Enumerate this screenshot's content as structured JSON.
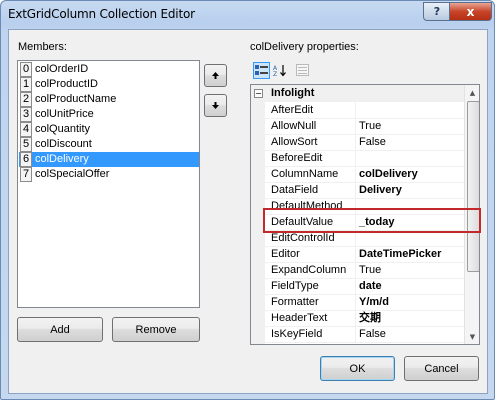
{
  "window": {
    "title": "ExtGridColumn Collection Editor"
  },
  "titlebar_buttons": {
    "help": "?",
    "close": "x"
  },
  "members": {
    "label": "Members:",
    "items": [
      {
        "index": "0",
        "name": "colOrderID"
      },
      {
        "index": "1",
        "name": "colProductID"
      },
      {
        "index": "2",
        "name": "colProductName"
      },
      {
        "index": "3",
        "name": "colUnitPrice"
      },
      {
        "index": "4",
        "name": "colQuantity"
      },
      {
        "index": "5",
        "name": "colDiscount"
      },
      {
        "index": "6",
        "name": "colDelivery",
        "selected": true
      },
      {
        "index": "7",
        "name": "colSpecialOffer"
      }
    ],
    "add_label": "Add",
    "remove_label": "Remove"
  },
  "move_buttons": {
    "up_icon": "arrow-up-icon",
    "down_icon": "arrow-down-icon"
  },
  "properties": {
    "label": "colDelivery properties:",
    "toolbar": [
      "categorized-icon",
      "alphabetical-icon",
      "property-pages-icon"
    ],
    "category": "Infolight",
    "rows": [
      {
        "name": "AfterEdit",
        "value": ""
      },
      {
        "name": "AllowNull",
        "value": "True"
      },
      {
        "name": "AllowSort",
        "value": "False"
      },
      {
        "name": "BeforeEdit",
        "value": ""
      },
      {
        "name": "ColumnName",
        "value": "colDelivery",
        "bold": true
      },
      {
        "name": "DataField",
        "value": "Delivery",
        "bold": true
      },
      {
        "name": "DefaultMethod",
        "value": ""
      },
      {
        "name": "DefaultValue",
        "value": "_today",
        "bold": true,
        "highlighted": true
      },
      {
        "name": "EditControlId",
        "value": ""
      },
      {
        "name": "Editor",
        "value": "DateTimePicker",
        "bold": true
      },
      {
        "name": "ExpandColumn",
        "value": "True"
      },
      {
        "name": "FieldType",
        "value": "date",
        "bold": true
      },
      {
        "name": "Formatter",
        "value": "Y/m/d",
        "bold": true
      },
      {
        "name": "HeaderText",
        "value": "交期",
        "bold": true
      },
      {
        "name": "IsKeyField",
        "value": "False"
      }
    ]
  },
  "footer": {
    "ok_label": "OK",
    "cancel_label": "Cancel"
  },
  "colors": {
    "selection": "#3399ff",
    "highlight_border": "#c2292c"
  }
}
